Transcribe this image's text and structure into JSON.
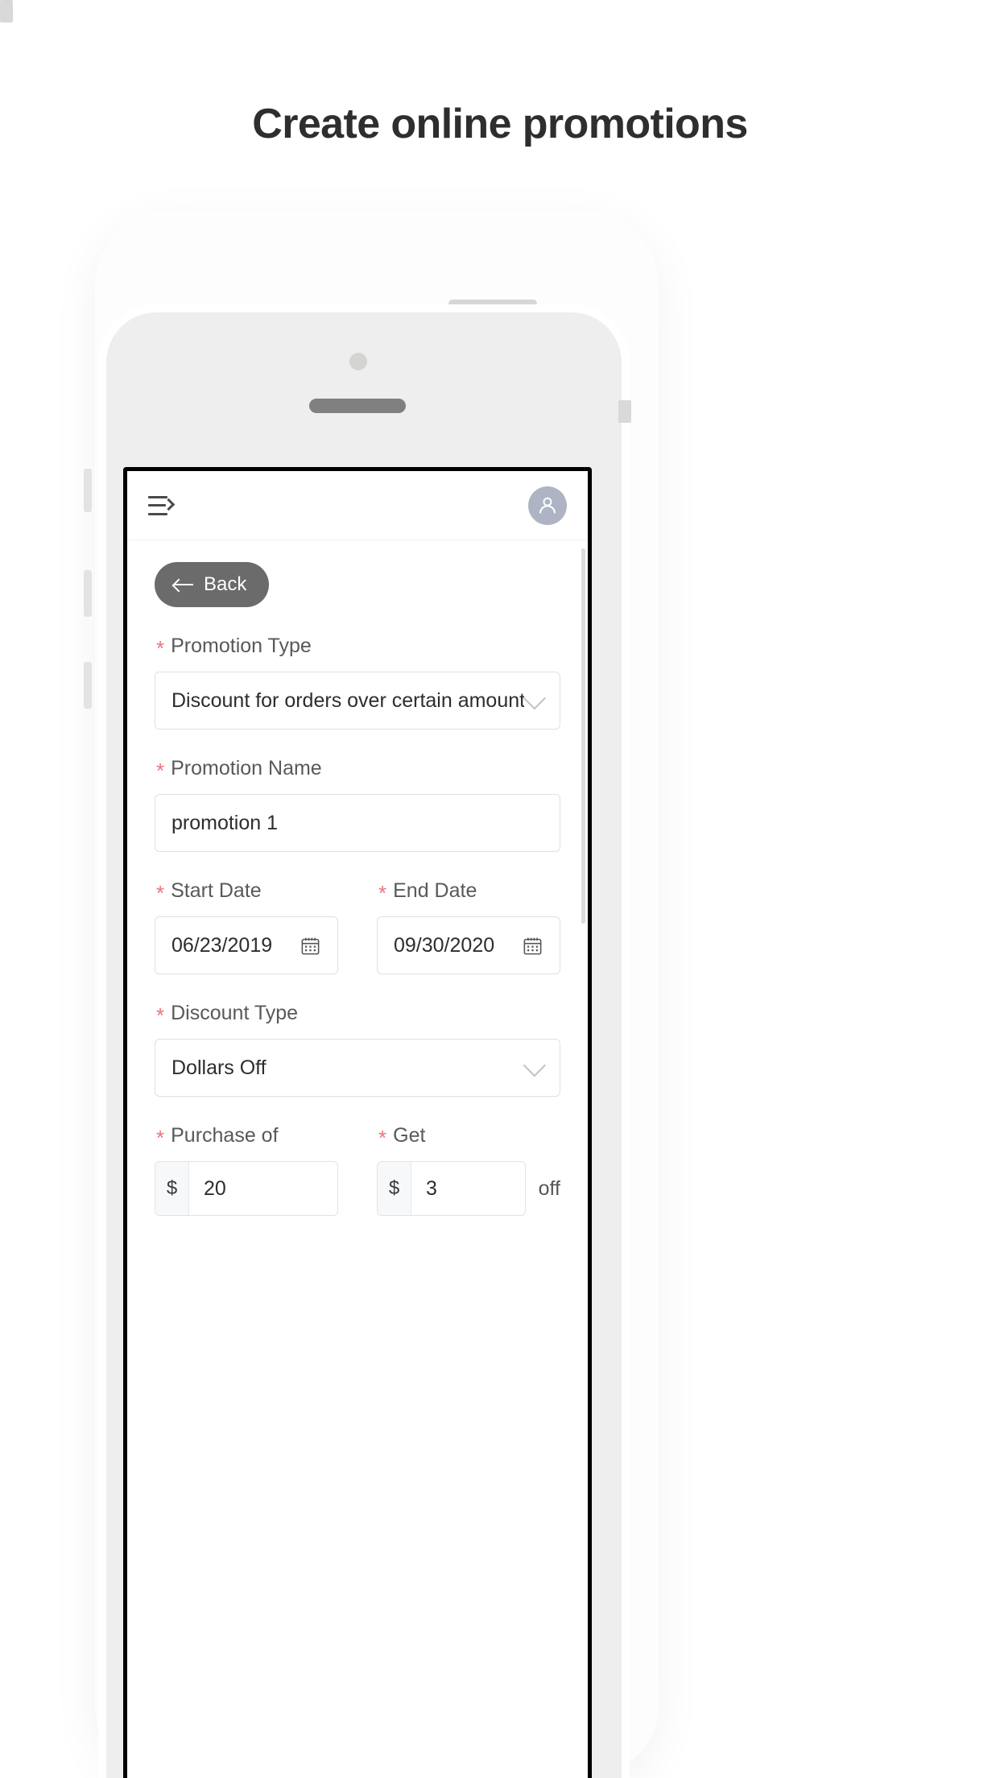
{
  "headline": "Create online promotions",
  "phone": {
    "camera_icon": "camera-dot",
    "speaker_icon": "speaker-grille"
  },
  "app": {
    "header": {
      "menu_icon": "menu-unfold-icon",
      "avatar_icon": "user-avatar-icon"
    },
    "back_button": {
      "label": "Back",
      "icon": "arrow-left-icon"
    },
    "form": {
      "required_marker": "*",
      "fields": [
        {
          "label": "Promotion Type",
          "type": "select",
          "value": "Discount for orders over certain amount",
          "icon": "chevron-down-icon"
        },
        {
          "label": "Promotion Name",
          "type": "text",
          "value": "promotion 1"
        },
        {
          "label": "Start Date",
          "type": "date",
          "value": "06/23/2019",
          "icon": "calendar-icon"
        },
        {
          "label": "End Date",
          "type": "date",
          "value": "09/30/2020",
          "icon": "calendar-icon"
        },
        {
          "label": "Discount Type",
          "type": "select",
          "value": "Dollars Off",
          "icon": "chevron-down-icon"
        },
        {
          "label": "Purchase of",
          "type": "currency",
          "symbol": "$",
          "value": "20"
        },
        {
          "label": "Get",
          "type": "currency",
          "symbol": "$",
          "value": "3",
          "suffix": "off"
        }
      ]
    }
  },
  "colors": {
    "headline": "#2e2e2e",
    "required_asterisk": "#e8757f",
    "back_button_bg": "#6b6b6b",
    "avatar_bg": "#aeb4c4",
    "label_text": "#595959",
    "border": "#e0e0e0"
  }
}
